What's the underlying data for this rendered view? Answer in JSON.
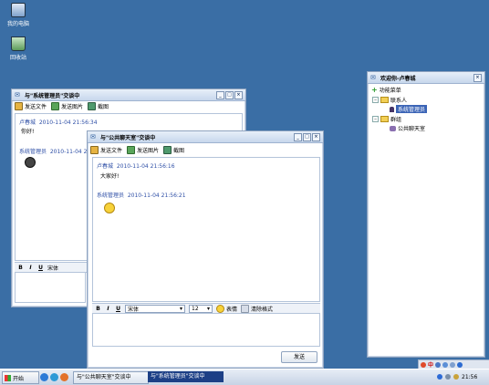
{
  "desktop": {
    "icons": [
      {
        "label": "我的电脑"
      },
      {
        "label": "回收站"
      }
    ]
  },
  "chat_admin": {
    "title": "与\"系统管理员\"交谈中",
    "toolbar": {
      "send_file": "发送文件",
      "send_image": "发送图片",
      "screenshot": "截图"
    },
    "messages": [
      {
        "sender": "卢春城",
        "time": "2010-11-04 21:56:34",
        "text": "你好!"
      },
      {
        "sender": "系统管理员",
        "time": "2010-11-04 21:56"
      }
    ],
    "format_bar": {
      "bold": "B",
      "italic": "I",
      "underline": "U",
      "font": "宋体"
    }
  },
  "chat_public": {
    "title": "与\"公共聊天室\"交谈中",
    "toolbar": {
      "send_file": "发送文件",
      "send_image": "发送图片",
      "screenshot": "截图"
    },
    "messages": [
      {
        "sender": "卢春城",
        "time": "2010-11-04 21:56:16",
        "text": "大家好!"
      },
      {
        "sender": "系统管理员",
        "time": "2010-11-04 21:56:21"
      }
    ],
    "format_bar": {
      "bold": "B",
      "italic": "I",
      "underline": "U",
      "font": "宋体",
      "size": "12",
      "emoji": "表情",
      "clear": "清除格式"
    },
    "send_button": "发送"
  },
  "contacts": {
    "title": "欢迎你-卢春城",
    "menu": "功能菜单",
    "groups": [
      {
        "label": "联系人",
        "items": [
          "系统管理员"
        ]
      },
      {
        "label": "群组",
        "items": [
          "公共聊天室"
        ]
      }
    ]
  },
  "taskbar": {
    "start": "开始",
    "tasks": [
      "与\"公共聊天室\"交谈中",
      "与\"系统管理员\"交谈中"
    ],
    "clock": "21:56",
    "ime": "中"
  },
  "colors": {
    "desktop": "#3a6ea5",
    "selection": "#3b64b6",
    "sender": "#2e4fa6",
    "active_task": "#1c3f86"
  }
}
